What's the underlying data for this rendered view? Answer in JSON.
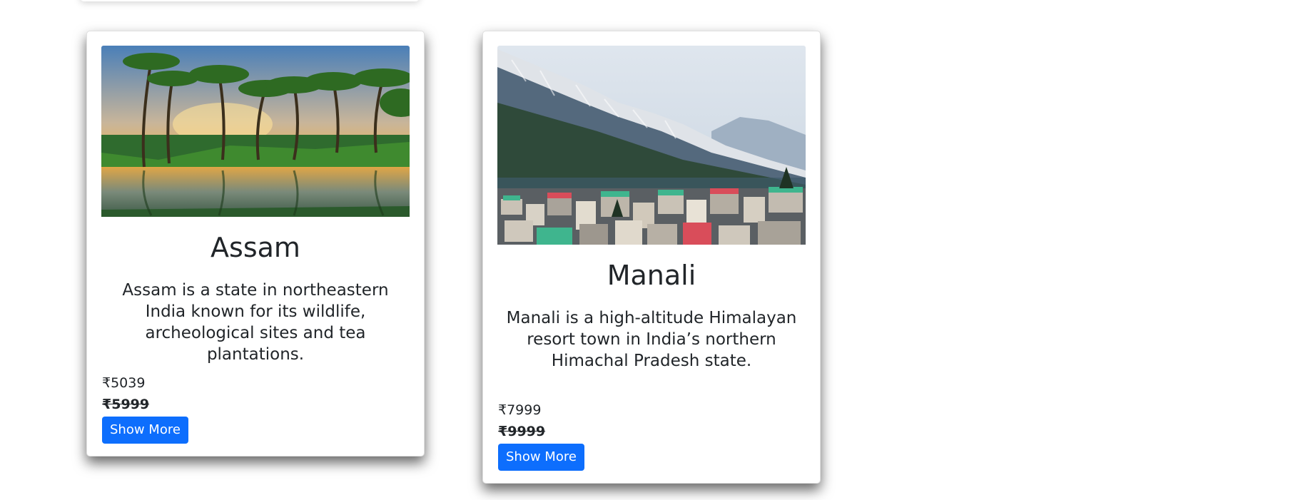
{
  "cards": [
    {
      "title": "Assam",
      "description": "Assam is a state in northeastern India known for its wildlife, archeological sites and tea plantations.",
      "price": "₹5039",
      "original_price": "₹5999",
      "button_label": "Show More",
      "image": "palm-trees-lake-sunset"
    },
    {
      "title": "Manali",
      "description": "Manali is a high-altitude Himalayan resort town in India’s northern Himachal Pradesh state.",
      "price": "₹7999",
      "original_price": "₹9999",
      "button_label": "Show More",
      "image": "snowy-mountains-town"
    }
  ],
  "colors": {
    "button": "#0d6efd",
    "text": "#212529"
  }
}
